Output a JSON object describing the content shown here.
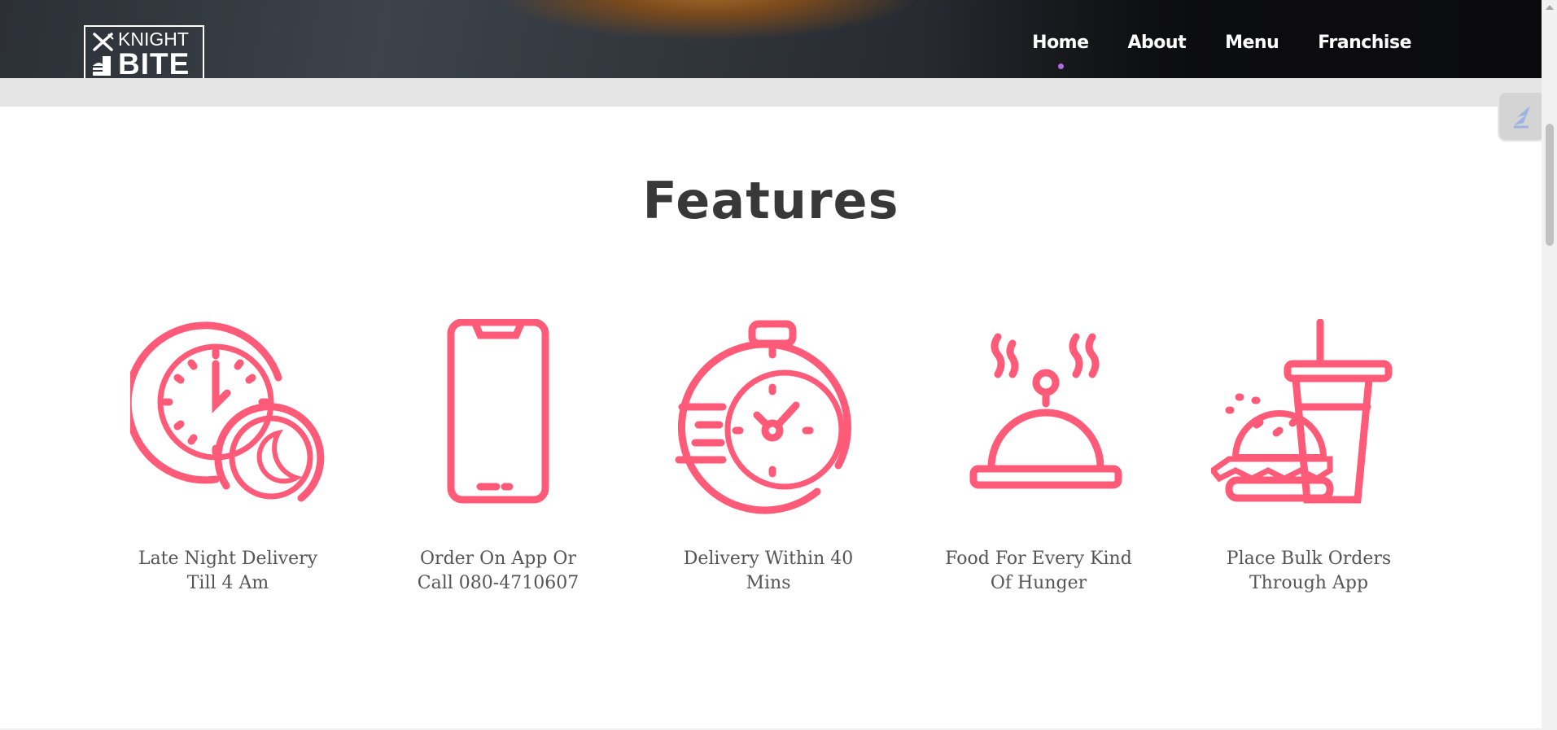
{
  "header": {
    "logo": {
      "line1": "KNIGHT",
      "line2": "BITE"
    },
    "nav": [
      {
        "label": "Home",
        "active": true
      },
      {
        "label": "About",
        "active": false
      },
      {
        "label": "Menu",
        "active": false
      },
      {
        "label": "Franchise",
        "active": false
      }
    ]
  },
  "main": {
    "title": "Features",
    "features": [
      {
        "icon": "clock-moon-icon",
        "label_line1": "Late Night Delivery",
        "label_line2": "Till 4 Am"
      },
      {
        "icon": "smartphone-icon",
        "label_line1": "Order On App Or",
        "label_line2": "Call 080-4710607"
      },
      {
        "icon": "stopwatch-icon",
        "label_line1": "Delivery Within 40",
        "label_line2": "Mins"
      },
      {
        "icon": "food-cloche-icon",
        "label_line1": "Food For Every Kind",
        "label_line2": "Of Hunger"
      },
      {
        "icon": "burger-drink-icon",
        "label_line1": "Place Bulk Orders",
        "label_line2": "Through App"
      }
    ]
  },
  "colors": {
    "accent": "#ff5a78",
    "active_dot": "#b06be0",
    "title": "#383838",
    "text": "#555555"
  }
}
